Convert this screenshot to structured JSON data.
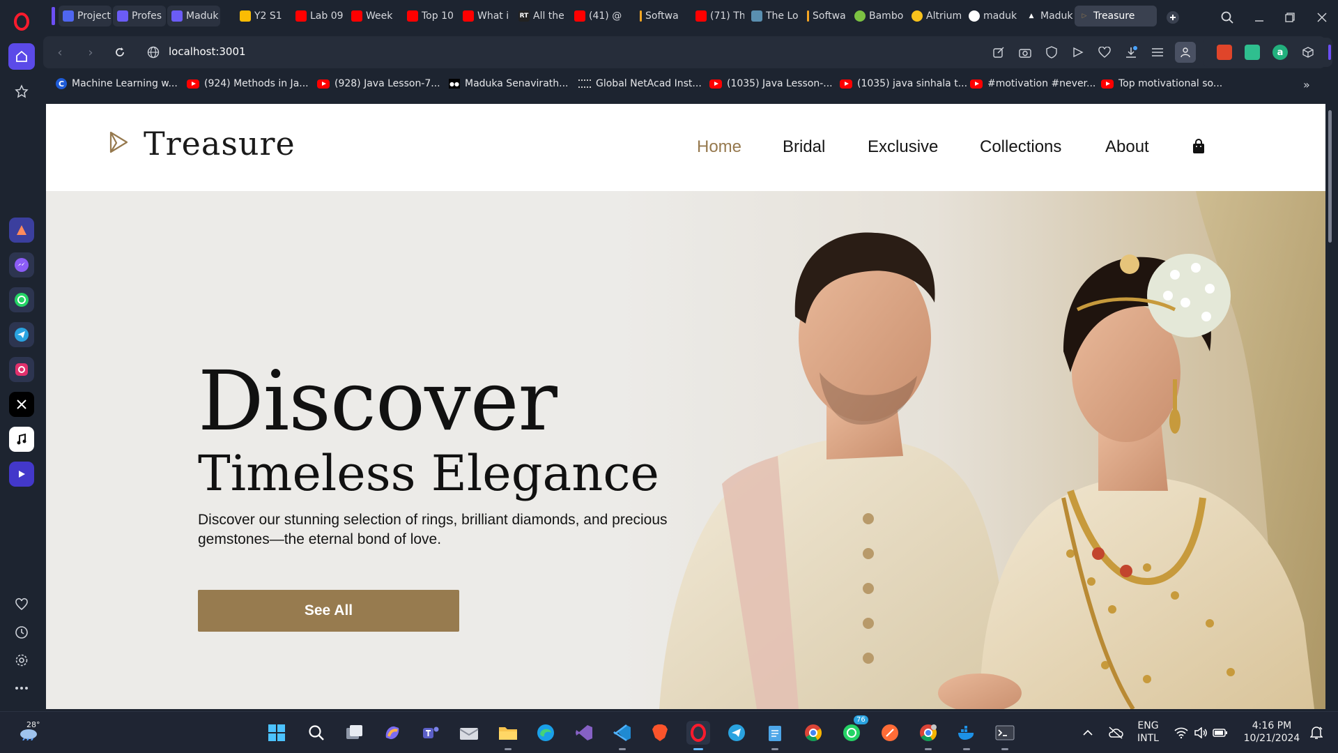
{
  "browser": {
    "tabs": [
      {
        "label": "Project",
        "fav": "#4f66f0"
      },
      {
        "label": "Profes",
        "fav": "#6b5cf6"
      },
      {
        "label": "Maduk",
        "fav": "#6b5cf6"
      },
      {
        "label": "Y2 S1",
        "fav": "#fbbc04"
      },
      {
        "label": "Lab 09",
        "fav": "#ff0000"
      },
      {
        "label": "Week",
        "fav": "#ff0000"
      },
      {
        "label": "Top 10",
        "fav": "#ff0000"
      },
      {
        "label": "What i",
        "fav": "#ff0000"
      },
      {
        "label": "All the",
        "fav": "#222222",
        "fav_text": "RT"
      },
      {
        "label": "(41) @",
        "fav": "#ff0000"
      },
      {
        "label": "Softwa",
        "fav": "#f5a623"
      },
      {
        "label": "(71) Th",
        "fav": "#ff0000"
      },
      {
        "label": "The Lo",
        "fav": "#5a8fb0"
      },
      {
        "label": "Softwa",
        "fav": "#f5a623"
      },
      {
        "label": "Bambo",
        "fav": "#7cc242"
      },
      {
        "label": "Altrium",
        "fav": "#f8c21c"
      },
      {
        "label": "maduk",
        "fav": "#ffffff"
      },
      {
        "label": "Maduk",
        "fav": "#ffffff"
      },
      {
        "label": "Treasure",
        "fav": "#96794e"
      }
    ],
    "url": "localhost:3001",
    "bookmarks": [
      {
        "label": "Machine Learning w...",
        "icon": "coursera-icon"
      },
      {
        "label": "(924) Methods in Ja...",
        "icon": "youtube-icon"
      },
      {
        "label": "(928) Java Lesson-7...",
        "icon": "youtube-icon"
      },
      {
        "label": "Maduka Senavirath...",
        "icon": "medium-icon"
      },
      {
        "label": "Global NetAcad Inst...",
        "icon": "cisco-icon"
      },
      {
        "label": "(1035) Java Lesson-...",
        "icon": "youtube-icon"
      },
      {
        "label": "(1035) java sinhala t...",
        "icon": "youtube-icon"
      },
      {
        "label": "#motivation #never...",
        "icon": "youtube-icon"
      },
      {
        "label": "Top motivational so...",
        "icon": "youtube-icon"
      }
    ]
  },
  "site": {
    "brand": "Treasure",
    "nav": [
      "Home",
      "Bridal",
      "Exclusive",
      "Collections",
      "About"
    ],
    "hero": {
      "title": "Discover",
      "subtitle": "Timeless Elegance",
      "desc_line1": "Discover our stunning selection of rings, brilliant diamonds, and precious",
      "desc_line2": "gemstones—the eternal bond of love.",
      "button": "See All"
    },
    "colors": {
      "accent": "#977b4f",
      "hero_bg": "#ecebe8",
      "nav_active": "#96794e"
    }
  },
  "taskbar": {
    "weather": "28°",
    "whatsapp_badge": "76",
    "lang_line1": "ENG",
    "lang_line2": "INTL",
    "time": "4:16 PM",
    "date": "10/21/2024"
  }
}
